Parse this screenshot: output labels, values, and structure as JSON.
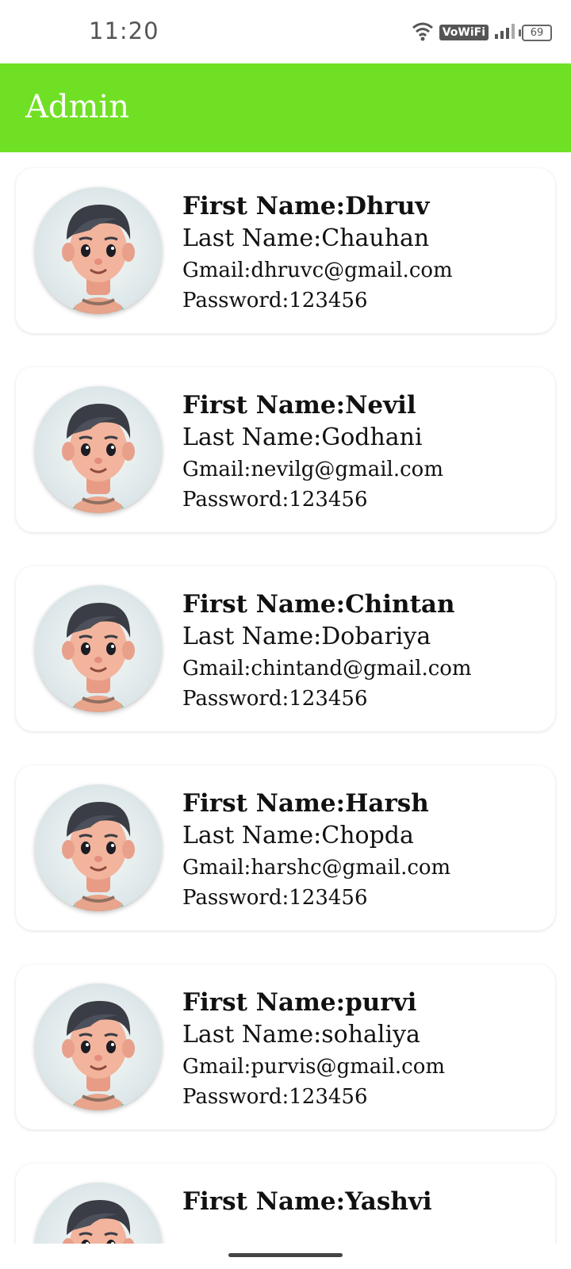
{
  "status_bar": {
    "time": "11:20",
    "icons": [
      "wifi-icon",
      "vowifi-badge",
      "signal-icon",
      "battery-icon"
    ],
    "vowifi": "VoWiFi",
    "battery": "69"
  },
  "app_bar": {
    "title": "Admin",
    "color": "#70e024"
  },
  "users": [
    {
      "first": "First Name:Dhruv",
      "last": "Last Name:Chauhan",
      "gmail": "Gmail:dhruvc@gmail.com",
      "password": "Password:123456"
    },
    {
      "first": "First Name:Nevil",
      "last": "Last Name:Godhani",
      "gmail": "Gmail:nevilg@gmail.com",
      "password": "Password:123456"
    },
    {
      "first": "First Name:Chintan",
      "last": "Last Name:Dobariya",
      "gmail": "Gmail:chintand@gmail.com",
      "password": "Password:123456"
    },
    {
      "first": "First Name:Harsh",
      "last": "Last Name:Chopda",
      "gmail": "Gmail:harshc@gmail.com",
      "password": "Password:123456"
    },
    {
      "first": "First Name:purvi",
      "last": "Last Name:sohaliya",
      "gmail": "Gmail:purvis@gmail.com",
      "password": "Password:123456"
    },
    {
      "first": "First Name:Yashvi",
      "last": "",
      "gmail": "",
      "password": ""
    }
  ]
}
